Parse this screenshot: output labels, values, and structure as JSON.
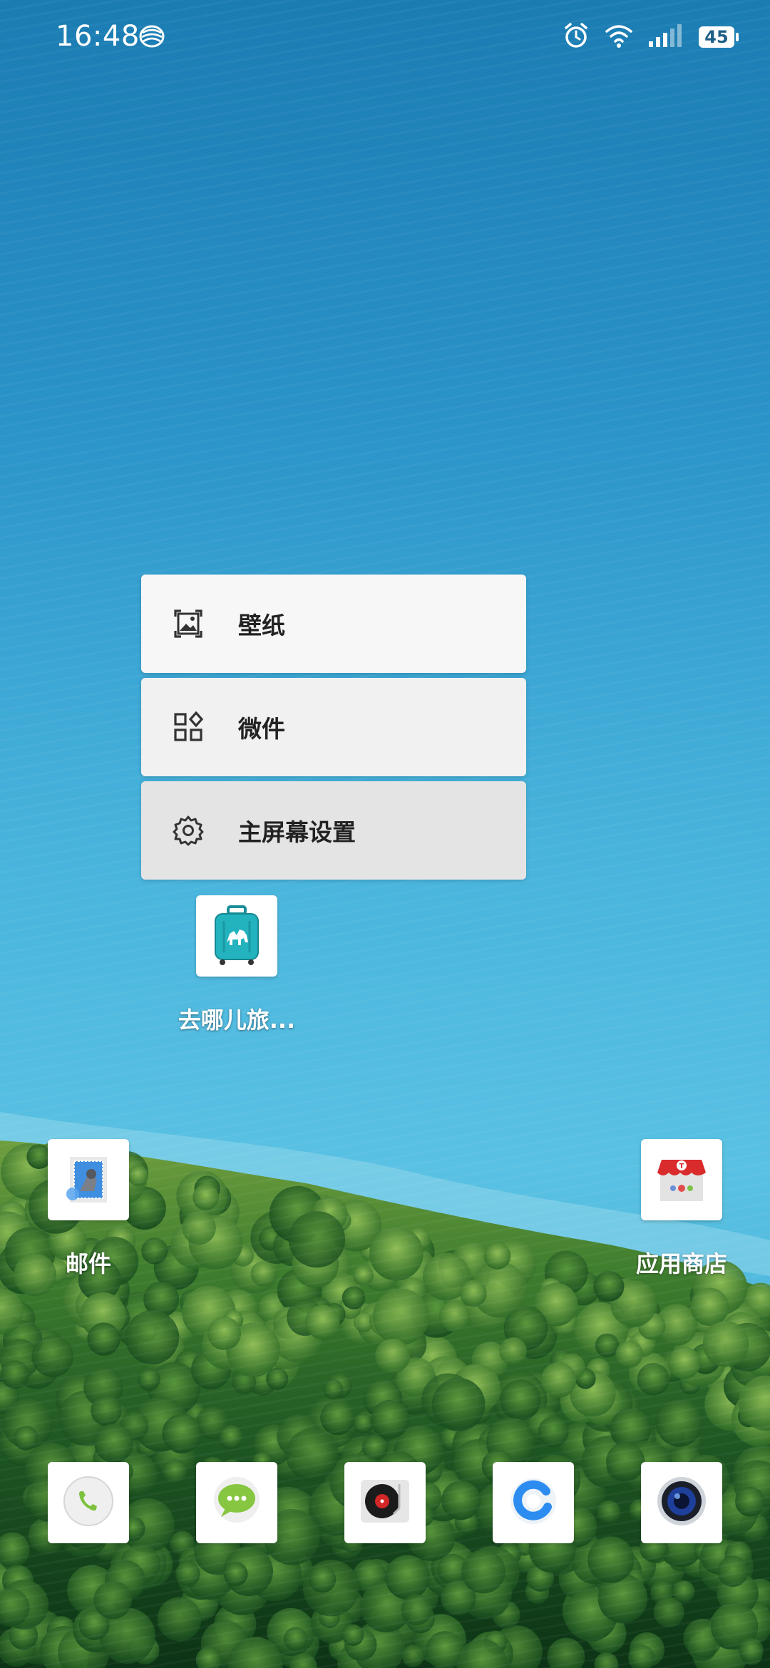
{
  "status_bar": {
    "time": "16:48",
    "battery": "45",
    "icons": [
      "carrier-icon",
      "alarm-icon",
      "wifi-icon",
      "signal-icon",
      "battery-icon"
    ]
  },
  "context_menu": {
    "items": [
      {
        "label": "壁纸",
        "icon": "wallpaper-icon"
      },
      {
        "label": "微件",
        "icon": "widgets-icon"
      },
      {
        "label": "主屏幕设置",
        "icon": "gear-icon"
      }
    ]
  },
  "home_apps": [
    {
      "label": "去哪儿旅...",
      "icon": "suitcase-camel-icon"
    },
    {
      "label": "邮件",
      "icon": "mail-icon"
    },
    {
      "label": "应用商店",
      "icon": "app-store-icon"
    }
  ],
  "dock": [
    {
      "icon": "phone-icon"
    },
    {
      "icon": "messages-icon"
    },
    {
      "icon": "music-icon"
    },
    {
      "icon": "browser-icon"
    },
    {
      "icon": "camera-icon"
    }
  ],
  "colors": {
    "sea_top": "#1d7fb4",
    "sea_mid": "#4db6dd",
    "forest": "#1f5a24"
  }
}
